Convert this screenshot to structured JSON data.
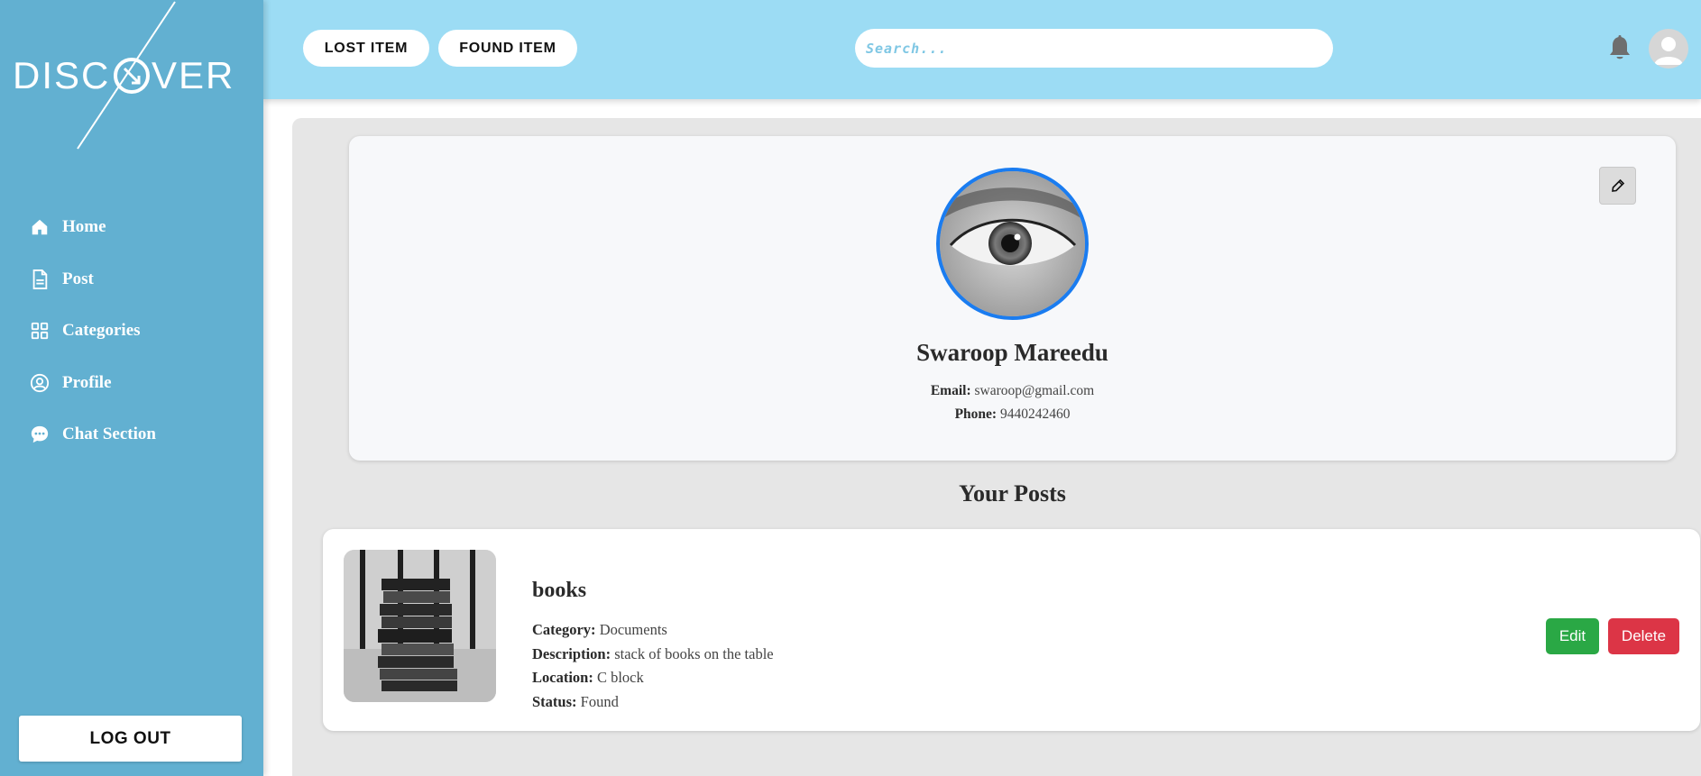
{
  "brand": {
    "logo_text": "DISCOVER"
  },
  "sidebar": {
    "items": [
      {
        "label": "Home",
        "icon": "home-icon"
      },
      {
        "label": "Post",
        "icon": "document-icon"
      },
      {
        "label": "Categories",
        "icon": "grid-icon"
      },
      {
        "label": "Profile",
        "icon": "user-circle-icon"
      },
      {
        "label": "Chat Section",
        "icon": "chat-icon"
      }
    ],
    "logout_label": "LOG OUT"
  },
  "header": {
    "lost_label": "LOST ITEM",
    "found_label": "FOUND ITEM",
    "search_placeholder": "Search...",
    "notification_icon": "bell-icon",
    "user_icon": "avatar-icon"
  },
  "profile": {
    "name": "Swaroop Mareedu",
    "email_label": "Email:",
    "email": "swaroop@gmail.com",
    "phone_label": "Phone:",
    "phone": "9440242460",
    "edit_icon": "edit-icon"
  },
  "posts": {
    "heading": "Your Posts",
    "items": [
      {
        "title": "books",
        "category_label": "Category:",
        "category": "Documents",
        "description_label": "Description:",
        "description": "stack of books on the table",
        "location_label": "Location:",
        "location": "C block",
        "status_label": "Status:",
        "status": "Found",
        "edit_label": "Edit",
        "delete_label": "Delete"
      }
    ]
  },
  "colors": {
    "sidebar": "#62b0d1",
    "header": "#9cdcf4",
    "accent_border": "#1a7cf0",
    "edit_button": "#2aa845",
    "delete_button": "#dc3546"
  }
}
